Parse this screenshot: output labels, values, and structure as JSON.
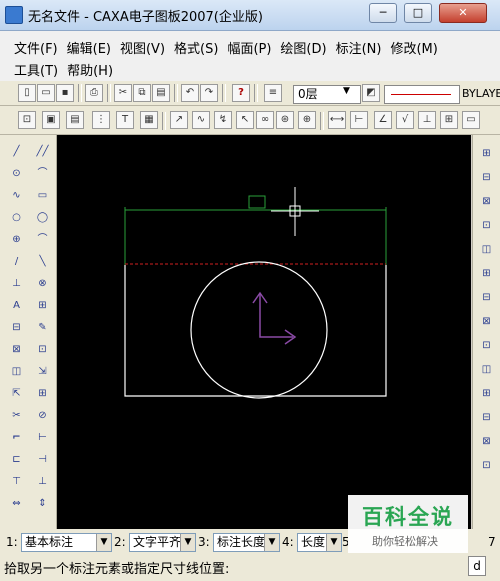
{
  "window": {
    "title": "无名文件 - CAXA电子图板2007(企业版)",
    "minimize": "─",
    "maximize": "□",
    "close": "✕"
  },
  "menu": {
    "row1": [
      "文件(F)",
      "编辑(E)",
      "视图(V)",
      "格式(S)",
      "幅面(P)",
      "绘图(D)",
      "标注(N)",
      "修改(M)"
    ],
    "row2": [
      "工具(T)",
      "帮助(H)"
    ]
  },
  "toolbar": {
    "layer": "0层",
    "linetype": "BYLAYER",
    "linecolor": "#cc0000"
  },
  "left_tools": [
    "╱",
    "╱╱",
    "⊙",
    "⌒",
    "∿",
    "▭",
    "○",
    "◯",
    "⊕",
    "⌒",
    "/",
    "╲",
    "⊥",
    "⊗",
    "A",
    "⊞",
    "⊟",
    "✎",
    "⊠",
    "⊡",
    "◫",
    "⇲",
    "⇱",
    "⊞",
    "✂",
    "⊘",
    "⌐",
    "⊢",
    "⊏",
    "⊣",
    "⊤",
    "⊥",
    "⇔",
    "⇕"
  ],
  "right_tools": [
    "⊞",
    "⊟",
    "⊠",
    "⊡",
    "◫",
    "⊞",
    "⊟",
    "⊠",
    "⊡",
    "◫",
    "⊞",
    "⊟",
    "⊠",
    "⊡"
  ],
  "immediate_menu": [
    {
      "num": "1:",
      "value": "基本标注"
    },
    {
      "num": "2:",
      "value": "文字平齐"
    },
    {
      "num": "3:",
      "value": "标注长度"
    },
    {
      "num": "4:",
      "value": "长度"
    },
    {
      "num": "5",
      "value": ""
    },
    {
      "num": "7",
      "value": ""
    }
  ],
  "prompt": "拾取另一个标注元素或指定尺寸线位置:",
  "prompt_input": "d",
  "watermark": {
    "logo": "百科全说",
    "sub": "助你轻松解决"
  },
  "colors": {
    "canvas": "#000000",
    "geometry": "#ffffff",
    "dimension": "#2aa03a",
    "centerline": "#d02020",
    "ucs": "#8a4aa6"
  }
}
